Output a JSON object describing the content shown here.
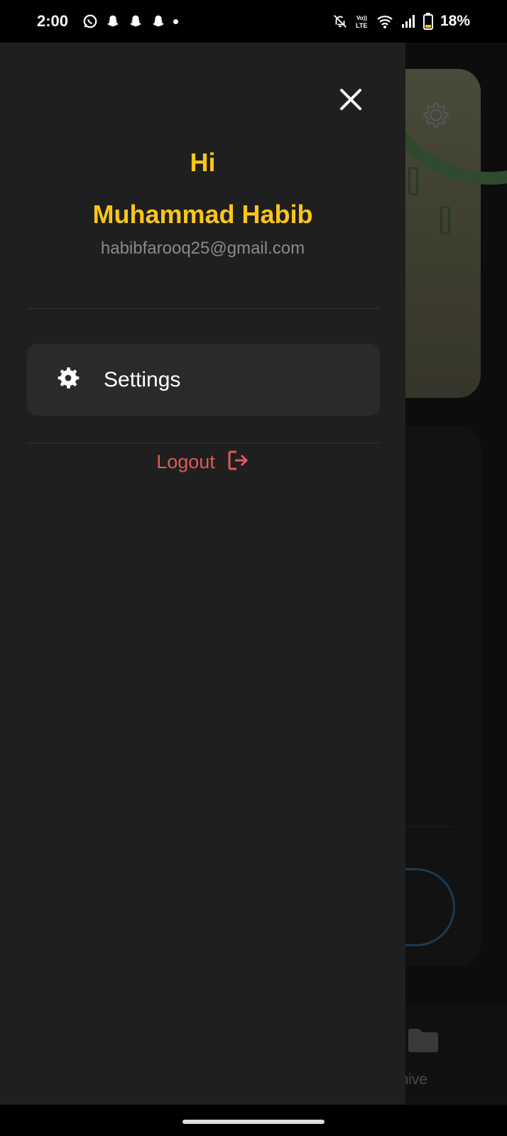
{
  "status_bar": {
    "time": "2:00",
    "battery_percent": "18%",
    "icons": [
      "whatsapp-icon",
      "snapchat-icon",
      "snapchat-icon",
      "snapchat-icon",
      "notification-dot",
      "mute-bell-icon",
      "volte-icon",
      "wifi-icon",
      "signal-icon",
      "battery-icon"
    ]
  },
  "drawer": {
    "greeting": "Hi",
    "user_name": "Muhammad Habib",
    "email": "habibfarooq25@gmail.com",
    "menu": [
      {
        "icon": "gear-icon",
        "label": "Settings"
      }
    ],
    "logout_label": "Logout"
  },
  "background": {
    "nav_label": "rchive"
  },
  "colors": {
    "accent": "#f8c51c",
    "logout": "#e0585b",
    "drawer_bg": "#1f1f1f",
    "menu_item_bg": "#2a2a2a"
  }
}
